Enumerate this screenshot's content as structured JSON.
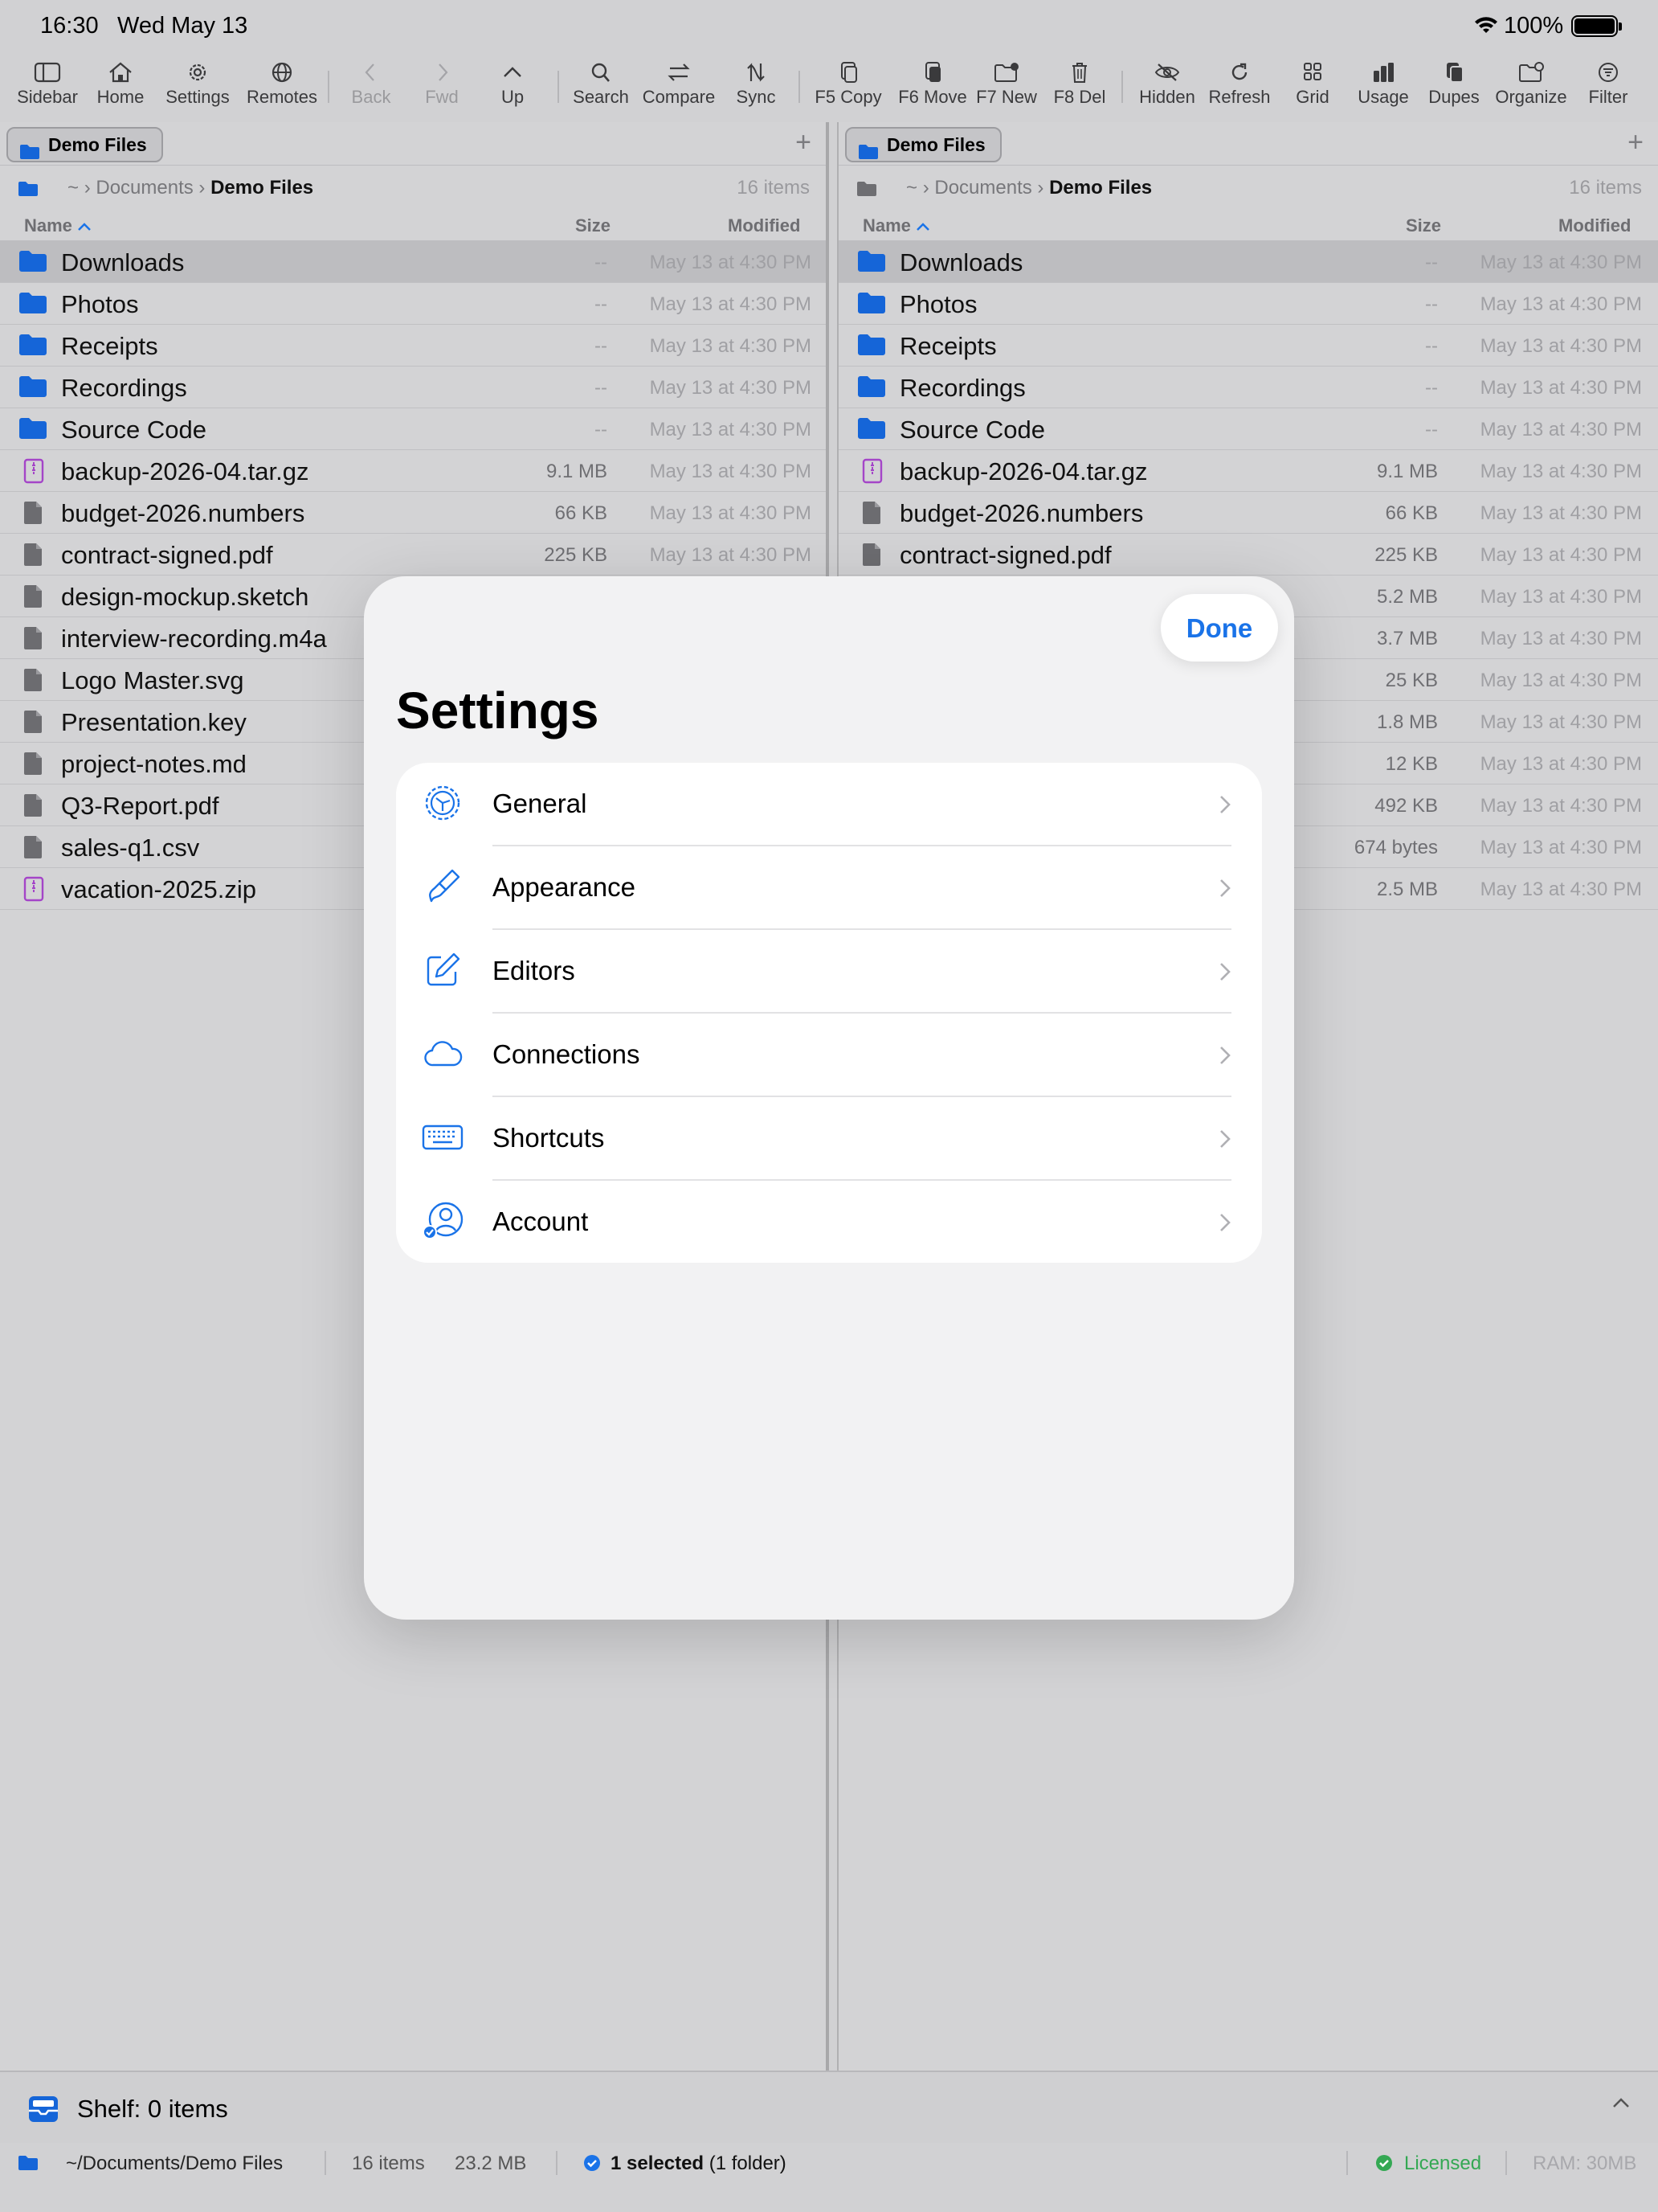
{
  "status_bar": {
    "time": "16:30",
    "date": "Wed May 13",
    "battery": "100%"
  },
  "toolbar": [
    {
      "label": "Sidebar",
      "icon": "sidebar-icon"
    },
    {
      "label": "Home",
      "icon": "home-icon"
    },
    {
      "label": "Settings",
      "icon": "gear-icon"
    },
    {
      "label": "Remotes",
      "icon": "globe-icon"
    },
    {
      "label": "Back",
      "icon": "chevron-left-icon"
    },
    {
      "label": "Fwd",
      "icon": "chevron-right-icon"
    },
    {
      "label": "Up",
      "icon": "chevron-up-icon"
    },
    {
      "label": "Search",
      "icon": "search-icon"
    },
    {
      "label": "Compare",
      "icon": "compare-icon"
    },
    {
      "label": "Sync",
      "icon": "sync-icon"
    },
    {
      "label": "F5 Copy",
      "icon": "copy-icon"
    },
    {
      "label": "F6 Move",
      "icon": "move-icon"
    },
    {
      "label": "F7 New",
      "icon": "new-folder-icon"
    },
    {
      "label": "F8 Del",
      "icon": "trash-icon"
    },
    {
      "label": "Hidden",
      "icon": "eye-slash-icon"
    },
    {
      "label": "Refresh",
      "icon": "refresh-icon"
    },
    {
      "label": "Grid",
      "icon": "grid-icon"
    },
    {
      "label": "Usage",
      "icon": "chart-icon"
    },
    {
      "label": "Dupes",
      "icon": "duplicates-icon"
    },
    {
      "label": "Organize",
      "icon": "organize-icon"
    },
    {
      "label": "Filter",
      "icon": "filter-icon"
    }
  ],
  "left_pane": {
    "tab": "Demo Files",
    "path": {
      "home": "~",
      "parent": "Documents",
      "current": "Demo Files"
    },
    "count": "16 items",
    "columns": {
      "name": "Name",
      "size": "Size",
      "modified": "Modified"
    }
  },
  "right_pane": {
    "tab": "Demo Files",
    "path": {
      "home": "~",
      "parent": "Documents",
      "current": "Demo Files"
    },
    "count": "16 items",
    "columns": {
      "name": "Name",
      "size": "Size",
      "modified": "Modified"
    }
  },
  "files": [
    {
      "name": "Downloads",
      "size": "--",
      "modified": "May 13 at 4:30 PM",
      "kind": "folder"
    },
    {
      "name": "Photos",
      "size": "--",
      "modified": "May 13 at 4:30 PM",
      "kind": "folder"
    },
    {
      "name": "Receipts",
      "size": "--",
      "modified": "May 13 at 4:30 PM",
      "kind": "folder"
    },
    {
      "name": "Recordings",
      "size": "--",
      "modified": "May 13 at 4:30 PM",
      "kind": "folder"
    },
    {
      "name": "Source Code",
      "size": "--",
      "modified": "May 13 at 4:30 PM",
      "kind": "folder"
    },
    {
      "name": "backup-2026-04.tar.gz",
      "size": "9.1 MB",
      "modified": "May 13 at 4:30 PM",
      "kind": "archive"
    },
    {
      "name": "budget-2026.numbers",
      "size": "66 KB",
      "modified": "May 13 at 4:30 PM",
      "kind": "file"
    },
    {
      "name": "contract-signed.pdf",
      "size": "225 KB",
      "modified": "May 13 at 4:30 PM",
      "kind": "file"
    },
    {
      "name": "design-mockup.sketch",
      "size": "5.2 MB",
      "modified": "May 13 at 4:30 PM",
      "kind": "file"
    },
    {
      "name": "interview-recording.m4a",
      "size": "3.7 MB",
      "modified": "May 13 at 4:30 PM",
      "kind": "file"
    },
    {
      "name": "Logo Master.svg",
      "size": "25 KB",
      "modified": "May 13 at 4:30 PM",
      "kind": "file"
    },
    {
      "name": "Presentation.key",
      "size": "1.8 MB",
      "modified": "May 13 at 4:30 PM",
      "kind": "file"
    },
    {
      "name": "project-notes.md",
      "size": "12 KB",
      "modified": "May 13 at 4:30 PM",
      "kind": "file"
    },
    {
      "name": "Q3-Report.pdf",
      "size": "492 KB",
      "modified": "May 13 at 4:30 PM",
      "kind": "file"
    },
    {
      "name": "sales-q1.csv",
      "size": "674 bytes",
      "modified": "May 13 at 4:30 PM",
      "kind": "file"
    },
    {
      "name": "vacation-2025.zip",
      "size": "2.5 MB",
      "modified": "May 13 at 4:30 PM",
      "kind": "archive"
    }
  ],
  "shelf": {
    "label": "Shelf: 0 items"
  },
  "statusline": {
    "path": "~/Documents/Demo Files",
    "items": "16 items",
    "size": "23.2 MB",
    "selection": "1 selected",
    "selection_detail": "(1 folder)",
    "license": "Licensed",
    "ram": "RAM: 30MB"
  },
  "settings": {
    "title": "Settings",
    "done": "Done",
    "items": [
      {
        "label": "General",
        "icon": "gear-icon"
      },
      {
        "label": "Appearance",
        "icon": "paintbrush-icon"
      },
      {
        "label": "Editors",
        "icon": "edit-icon"
      },
      {
        "label": "Connections",
        "icon": "cloud-icon"
      },
      {
        "label": "Shortcuts",
        "icon": "keyboard-icon"
      },
      {
        "label": "Account",
        "icon": "account-icon"
      }
    ]
  },
  "colors": {
    "accent": "#1a73e8",
    "folder": "#1565d8",
    "archive": "#a445c8",
    "license": "#34a853"
  }
}
